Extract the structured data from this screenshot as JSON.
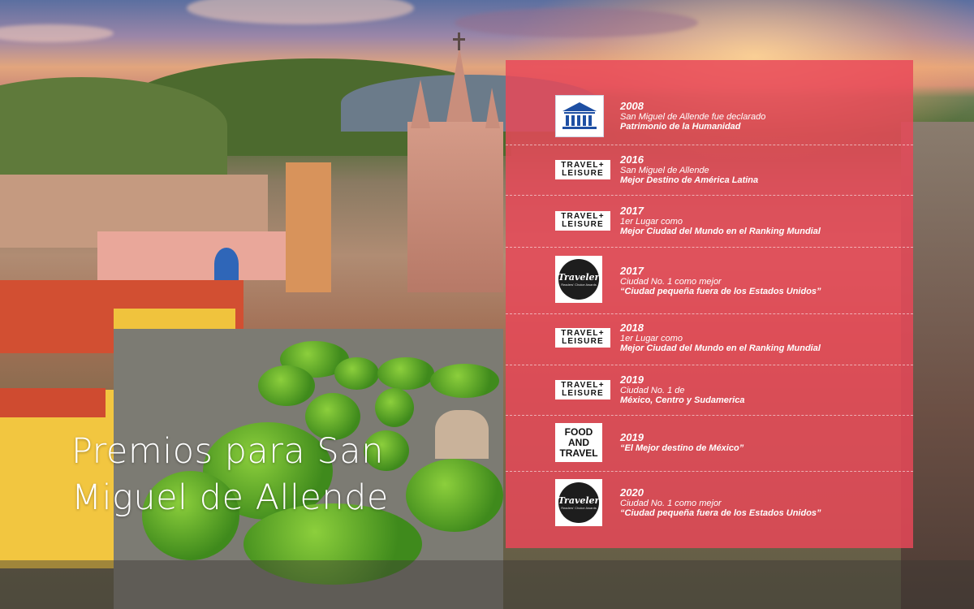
{
  "title": {
    "line1": "Premios para San",
    "line2": "Miguel de Allende"
  },
  "colors": {
    "panel": "#e84858",
    "title_text": "#ffffff"
  },
  "awards": [
    {
      "logo": "unesco-logo-icon",
      "logo_text": "UNESCO",
      "year": "2008",
      "line1": "San Miguel de Allende fue declarado",
      "line2": "Patrimonio de la Humanidad"
    },
    {
      "logo": "travel-leisure-logo-icon",
      "logo_text_1": "TRAVEL+",
      "logo_text_2": "LEISURE",
      "year": "2016",
      "line1": "San Miguel de Allende",
      "line2": "Mejor Destino de América Latina"
    },
    {
      "logo": "travel-leisure-logo-icon",
      "logo_text_1": "TRAVEL+",
      "logo_text_2": "LEISURE",
      "year": "2017",
      "line1": "1er Lugar como",
      "line2": "Mejor Ciudad del Mundo en el Ranking Mundial"
    },
    {
      "logo": "conde-nast-traveler-logo-icon",
      "logo_text_1": "Traveler",
      "logo_text_2": "Readers' Choice Awards",
      "year": "2017",
      "line1": "Ciudad No. 1 como mejor",
      "line2": "“Ciudad pequeña fuera de los Estados Unidos”"
    },
    {
      "logo": "travel-leisure-logo-icon",
      "logo_text_1": "TRAVEL+",
      "logo_text_2": "LEISURE",
      "year": "2018",
      "line1": "1er Lugar como",
      "line2": "Mejor Ciudad del Mundo en el Ranking Mundial"
    },
    {
      "logo": "travel-leisure-logo-icon",
      "logo_text_1": "TRAVEL+",
      "logo_text_2": "LEISURE",
      "year": "2019",
      "line1": "Ciudad No. 1 de",
      "line2": "México, Centro y Sudamerica"
    },
    {
      "logo": "food-and-travel-logo-icon",
      "logo_text_1": "FOOD",
      "logo_text_2": "AND",
      "logo_text_3": "TRAVEL",
      "year": "2019",
      "line1": "“El Mejor destino de México”"
    },
    {
      "logo": "conde-nast-traveler-logo-icon",
      "logo_text_1": "Traveler",
      "logo_text_2": "Readers' Choice Awards",
      "year": "2020",
      "line1": "Ciudad No. 1 como mejor",
      "line2": "“Ciudad pequeña fuera de los Estados Unidos”"
    }
  ]
}
